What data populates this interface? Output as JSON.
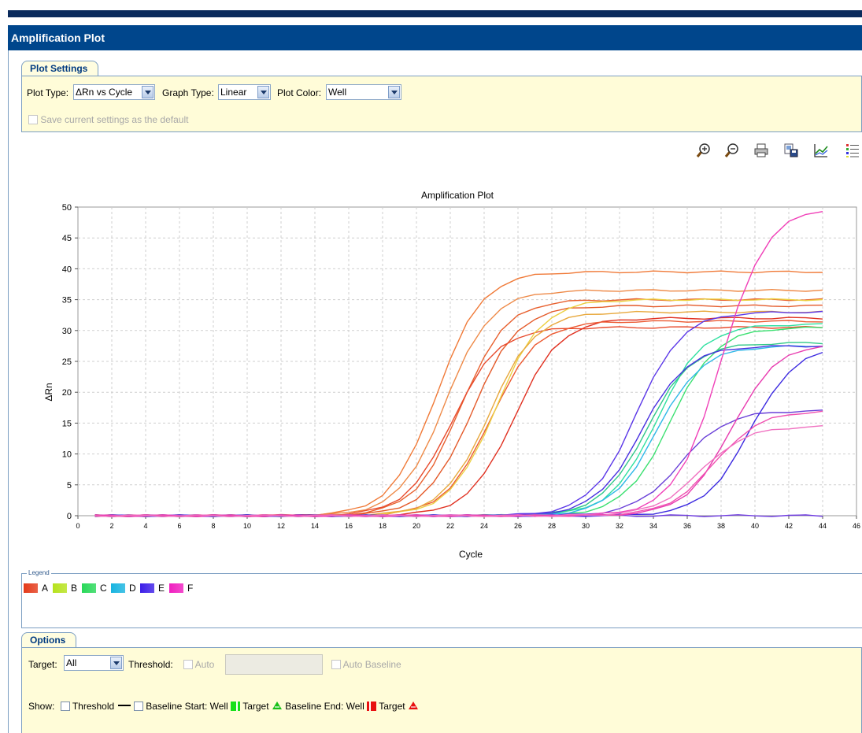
{
  "window": {
    "title": "Amplification Plot"
  },
  "plot_settings": {
    "tab_label": "Plot Settings",
    "plot_type_label": "Plot Type:",
    "plot_type_value": "ΔRn vs Cycle",
    "graph_type_label": "Graph Type:",
    "graph_type_value": "Linear",
    "plot_color_label": "Plot Color:",
    "plot_color_value": "Well",
    "save_default_label": "Save current settings as the default"
  },
  "toolbar": {
    "icons": [
      "zoom-in-icon",
      "zoom-out-icon",
      "print-icon",
      "save-image-icon",
      "graph-icon",
      "legend-list-icon"
    ]
  },
  "legend": {
    "title": "Legend",
    "items": [
      {
        "label": "A",
        "color": "#e43a1a"
      },
      {
        "label": "B",
        "color": "#b6e21c"
      },
      {
        "label": "C",
        "color": "#28d858"
      },
      {
        "label": "D",
        "color": "#18b4e0"
      },
      {
        "label": "E",
        "color": "#3c1ee8"
      },
      {
        "label": "F",
        "color": "#f01ec0"
      }
    ]
  },
  "options": {
    "tab_label": "Options",
    "target_label": "Target:",
    "target_value": "All",
    "threshold_label": "Threshold:",
    "auto_label": "Auto",
    "auto_baseline_label": "Auto Baseline",
    "show_label": "Show:",
    "threshold_check_label": "Threshold",
    "baseline_start_label": "Baseline Start: Well",
    "target_label_1": "Target",
    "baseline_end_label": "Baseline End: Well",
    "target_label_2": "Target"
  },
  "chart_data": {
    "type": "line",
    "title": "Amplification Plot",
    "xlabel": "Cycle",
    "ylabel": "ΔRn",
    "xlim": [
      0,
      46
    ],
    "ylim": [
      0,
      50
    ],
    "xticks": [
      0,
      2,
      4,
      6,
      8,
      10,
      12,
      14,
      16,
      18,
      20,
      22,
      24,
      26,
      28,
      30,
      32,
      34,
      36,
      38,
      40,
      42,
      44,
      46
    ],
    "yticks": [
      0,
      5,
      10,
      15,
      20,
      25,
      30,
      35,
      40,
      45,
      50
    ],
    "grid": true,
    "series": [
      {
        "name": "A",
        "color": "#f07a38",
        "ct": 21.2,
        "plateau": 39.5
      },
      {
        "name": "A",
        "color": "#ee8a48",
        "ct": 21.7,
        "plateau": 36.5
      },
      {
        "name": "A",
        "color": "#e8602e",
        "ct": 22.6,
        "plateau": 35.0
      },
      {
        "name": "A",
        "color": "#e45a2a",
        "ct": 23.3,
        "plateau": 34.0
      },
      {
        "name": "A",
        "color": "#e84a2c",
        "ct": 22.1,
        "plateau": 30.5
      },
      {
        "name": "A",
        "color": "#e03020",
        "ct": 25.8,
        "plateau": 32.0
      },
      {
        "name": "A",
        "color": "#ec5a32",
        "ct": 24.4,
        "plateau": 31.5
      },
      {
        "name": "B",
        "color": "#ecd040",
        "ct": 24.7,
        "plateau": 35.0
      },
      {
        "name": "B",
        "color": "#e8a83c",
        "ct": 24.3,
        "plateau": 33.0
      },
      {
        "name": "C",
        "color": "#2ee0a0",
        "ct": 34.2,
        "plateau": 31.0
      },
      {
        "name": "C",
        "color": "#3ae070",
        "ct": 35.0,
        "plateau": 30.5
      },
      {
        "name": "C",
        "color": "#30c888",
        "ct": 33.6,
        "plateau": 28.0
      },
      {
        "name": "D",
        "color": "#30b8e8",
        "ct": 34.2,
        "plateau": 27.5
      },
      {
        "name": "E",
        "color": "#4830e0",
        "ct": 33.3,
        "plateau": 27.5
      },
      {
        "name": "E",
        "color": "#5a36e8",
        "ct": 33.0,
        "plateau": 33.0
      },
      {
        "name": "E",
        "color": "#6a40d8",
        "ct": 35.6,
        "plateau": 17.0
      },
      {
        "name": "E",
        "color": "#3c2ae0",
        "ct": 39.7,
        "plateau": 27.5
      },
      {
        "name": "E",
        "color": "#6c38e0",
        "ct": 0,
        "plateau": 0
      },
      {
        "name": "F",
        "color": "#f040b8",
        "ct": 38.0,
        "plateau": 50.0
      },
      {
        "name": "F",
        "color": "#e83cb0",
        "ct": 38.6,
        "plateau": 28.0
      },
      {
        "name": "F",
        "color": "#f050b0",
        "ct": 37.6,
        "plateau": 17.0
      },
      {
        "name": "F",
        "color": "#f070c0",
        "ct": 36.8,
        "plateau": 14.5
      }
    ]
  }
}
